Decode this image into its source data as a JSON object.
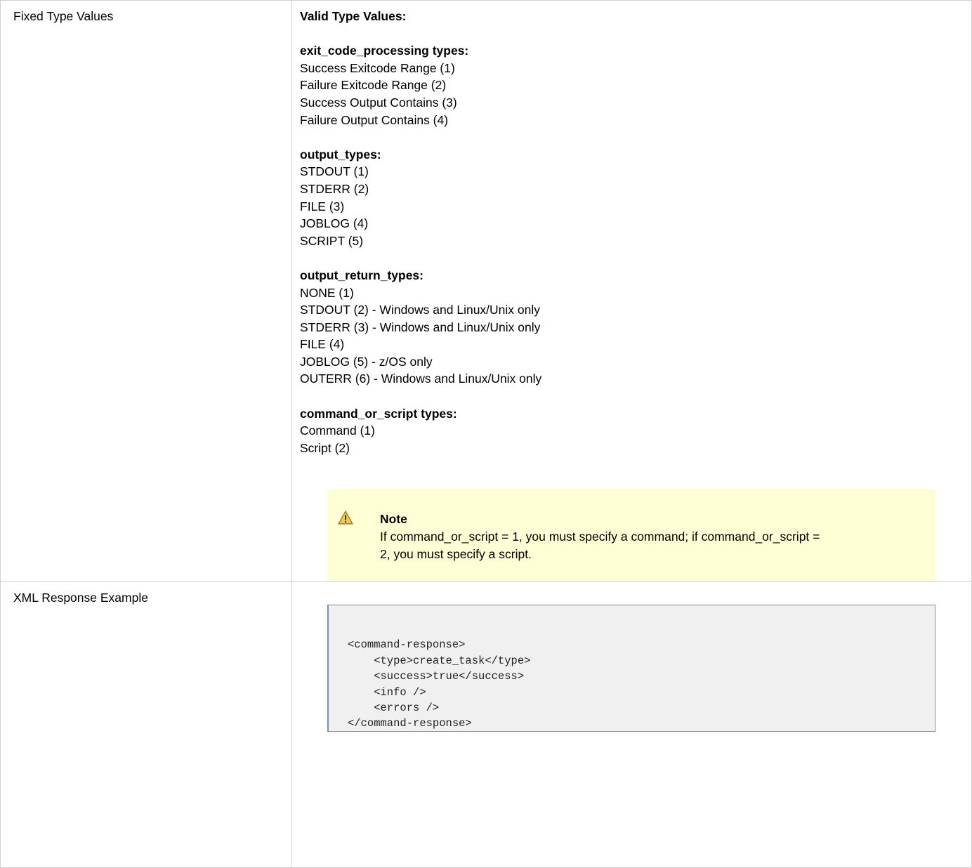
{
  "rows": {
    "fixed_type_values": {
      "label": "Fixed Type Values",
      "heading": "Valid Type Values:",
      "groups": [
        {
          "title": "exit_code_processing types:",
          "items": [
            "Success Exitcode Range (1)",
            "Failure Exitcode Range (2)",
            "Success Output Contains (3)",
            "Failure Output Contains (4)"
          ]
        },
        {
          "title": "output_types:",
          "items": [
            "STDOUT (1)",
            "STDERR (2)",
            "FILE (3)",
            "JOBLOG (4)",
            "SCRIPT (5)"
          ]
        },
        {
          "title": "output_return_types:",
          "items": [
            "NONE (1)",
            "STDOUT (2) - Windows and Linux/Unix only",
            "STDERR (3) - Windows and Linux/Unix only",
            "FILE (4)",
            "JOBLOG (5) - z/OS only",
            "OUTERR (6) - Windows and Linux/Unix only"
          ]
        },
        {
          "title": "command_or_script types:",
          "items": [
            "Command (1)",
            "Script (2)"
          ]
        }
      ],
      "note": {
        "icon": "warning-icon",
        "title": "Note",
        "text_line1": "If command_or_script = 1, you must specify a command; if command_or_script =",
        "text_line2": "2, you must specify a script."
      }
    },
    "xml_response_example": {
      "label": "XML Response Example",
      "code_lines": [
        "<command-response>",
        "    <type>create_task</type>",
        "    <success>true</success>",
        "    <info />",
        "    <errors />",
        "</command-response>"
      ]
    }
  },
  "colors": {
    "note_background": "#ffffd6",
    "code_background": "#f0f0f0",
    "code_border": "#6f8fc2",
    "table_border": "#d0d0d0",
    "warning_icon_fill": "#f2c94c"
  }
}
